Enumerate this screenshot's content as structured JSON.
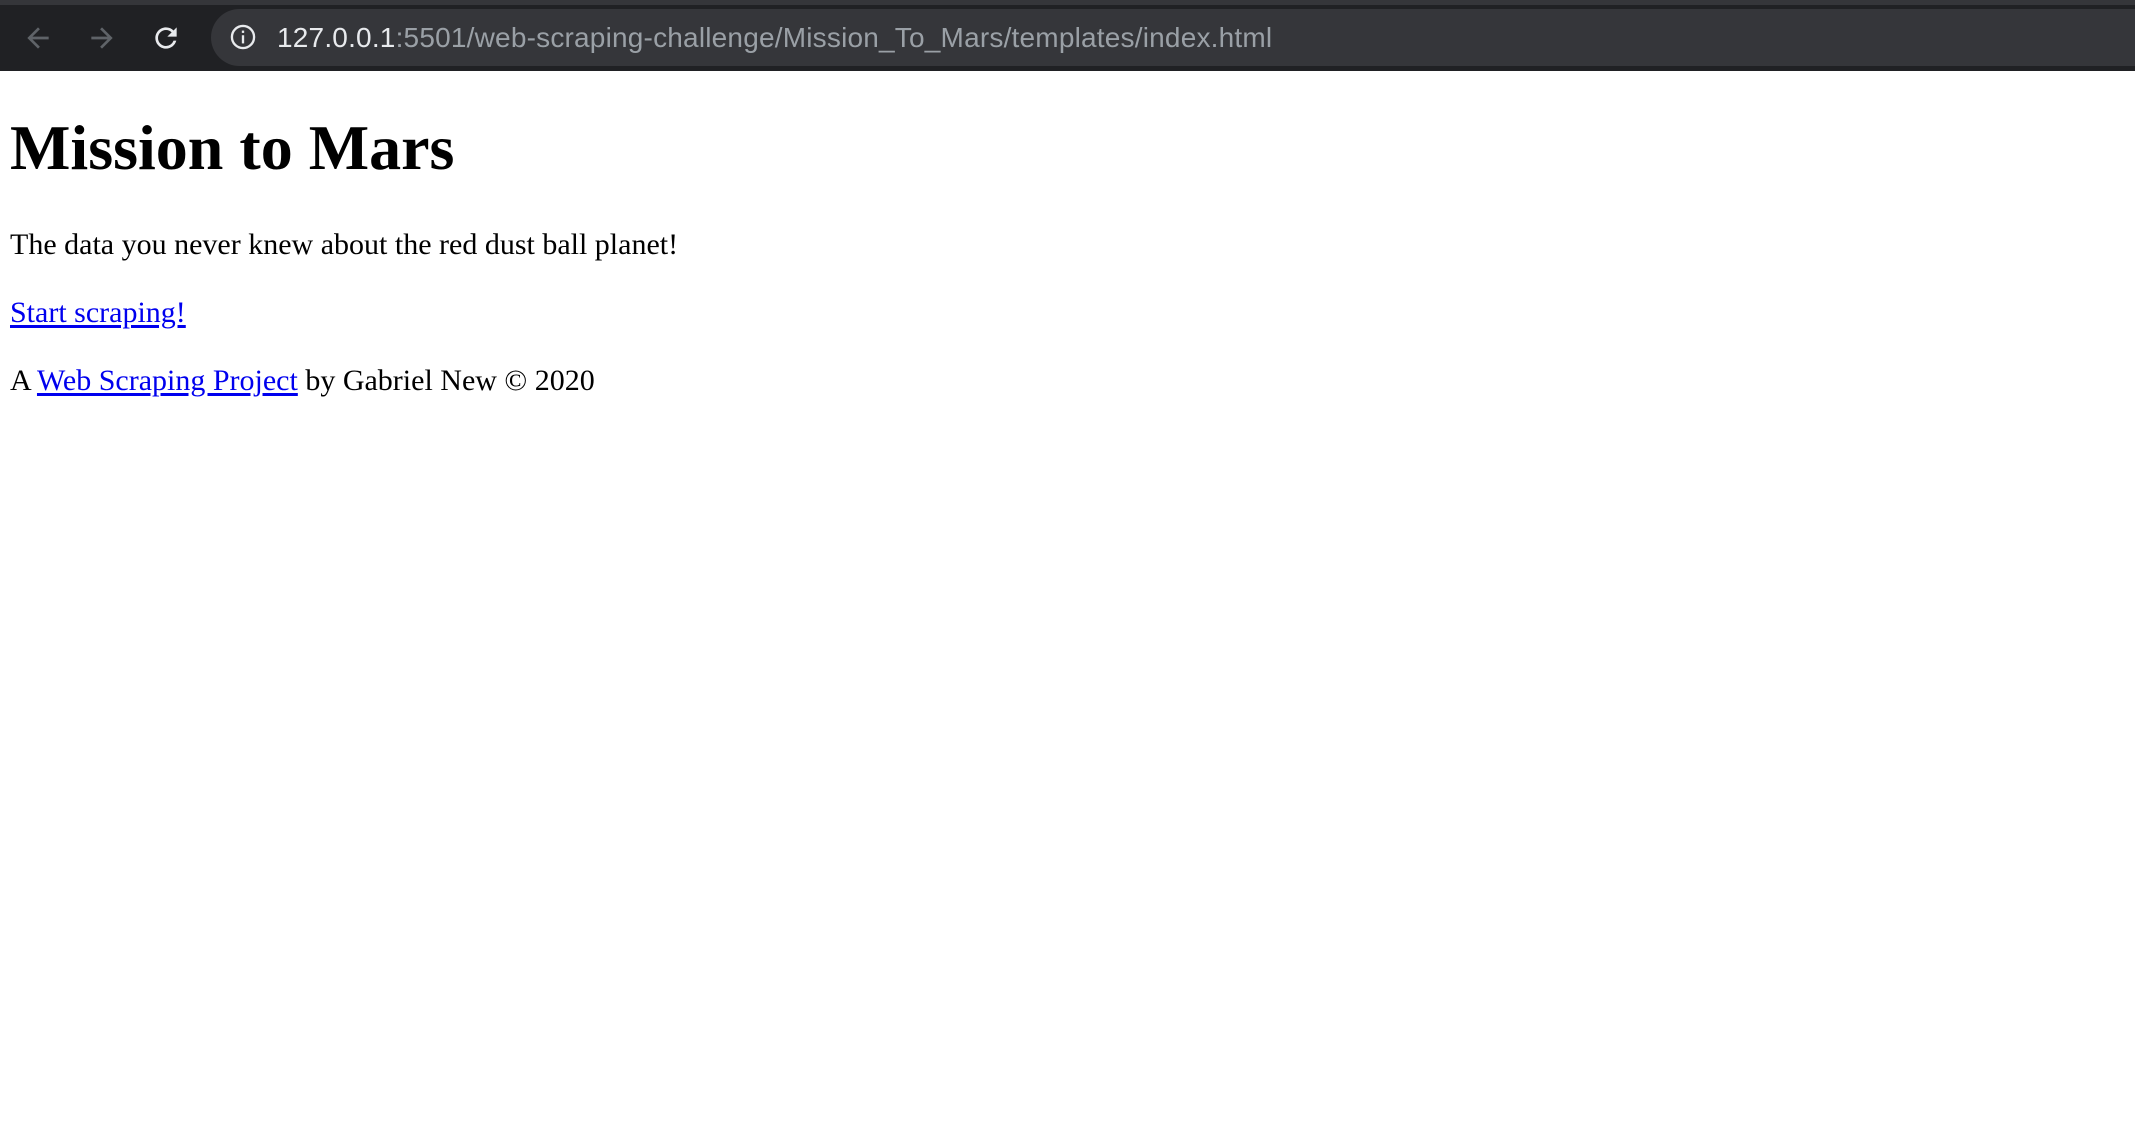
{
  "browser": {
    "url_host": "127.0.0.1",
    "url_rest": ":5501/web-scraping-challenge/Mission_To_Mars/templates/index.html",
    "icons": {
      "back": "arrow-left-icon",
      "forward": "arrow-right-icon",
      "reload": "reload-icon",
      "info": "info-icon"
    }
  },
  "page": {
    "title": "Mission to Mars",
    "tagline": "The data you never knew about the red dust ball planet!",
    "scrape_link": "Start scraping!",
    "footer": {
      "prefix": "A ",
      "link": "Web Scraping Project",
      "suffix": " by Gabriel New © 2020"
    }
  },
  "colors": {
    "link": "#0000ee",
    "toolbar": "#202124",
    "omnibox": "#35363a"
  }
}
